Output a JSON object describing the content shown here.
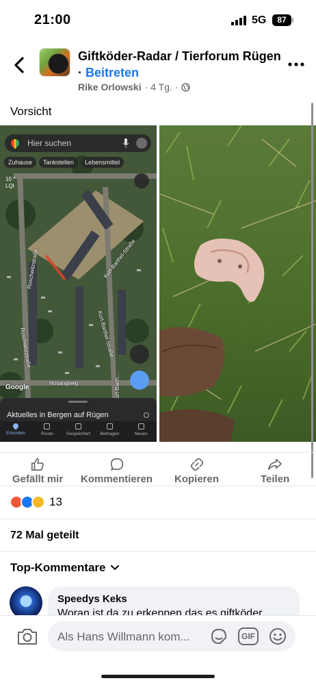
{
  "status_bar": {
    "time": "21:00",
    "network": "5G",
    "battery": "87"
  },
  "post": {
    "group_name": "Giftköder-Radar / Tierforum Rügen",
    "separator": " · ",
    "join_label": "Beitreten",
    "author": "Rike Orlowski",
    "age": "· 4 Tg. ·",
    "text": "Vorsicht"
  },
  "map_screenshot": {
    "search_placeholder": "Hier suchen",
    "chips": [
      "Zuhause",
      "Tankstellen",
      "Lebensmittel"
    ],
    "weather": {
      "temp": "10 °",
      "aqi": "LQI"
    },
    "streets": [
      "Ruschwitzstraße",
      "Kurt-Barthel-Straße",
      "Kurt-Barthel-Straße",
      "Ruschwitzstraße",
      "Hosangweg",
      "Kurt-Barth..."
    ],
    "google_label": "Google",
    "sheet_title": "Aktuelles in Bergen auf Rügen",
    "tabs": [
      "Erkunden",
      "Route",
      "Gespeichert",
      "Beitragen",
      "Neues"
    ]
  },
  "actions": {
    "like": "Gefällt mir",
    "comment": "Kommentieren",
    "copy": "Kopieren",
    "share": "Teilen"
  },
  "reactions": {
    "count": "13"
  },
  "shares": "72 Mal geteilt",
  "top_comments_label": "Top-Kommentare",
  "comment": {
    "author": "Speedys Keks",
    "text": "Woran ist da zu erkennen das es giftköder"
  },
  "composer": {
    "placeholder": "Als Hans Willmann kom...",
    "gif_label": "GIF"
  },
  "colors": {
    "accent": "#1877f2",
    "secondary_text": "#65676b",
    "bubble_bg": "#f0f2f5"
  }
}
